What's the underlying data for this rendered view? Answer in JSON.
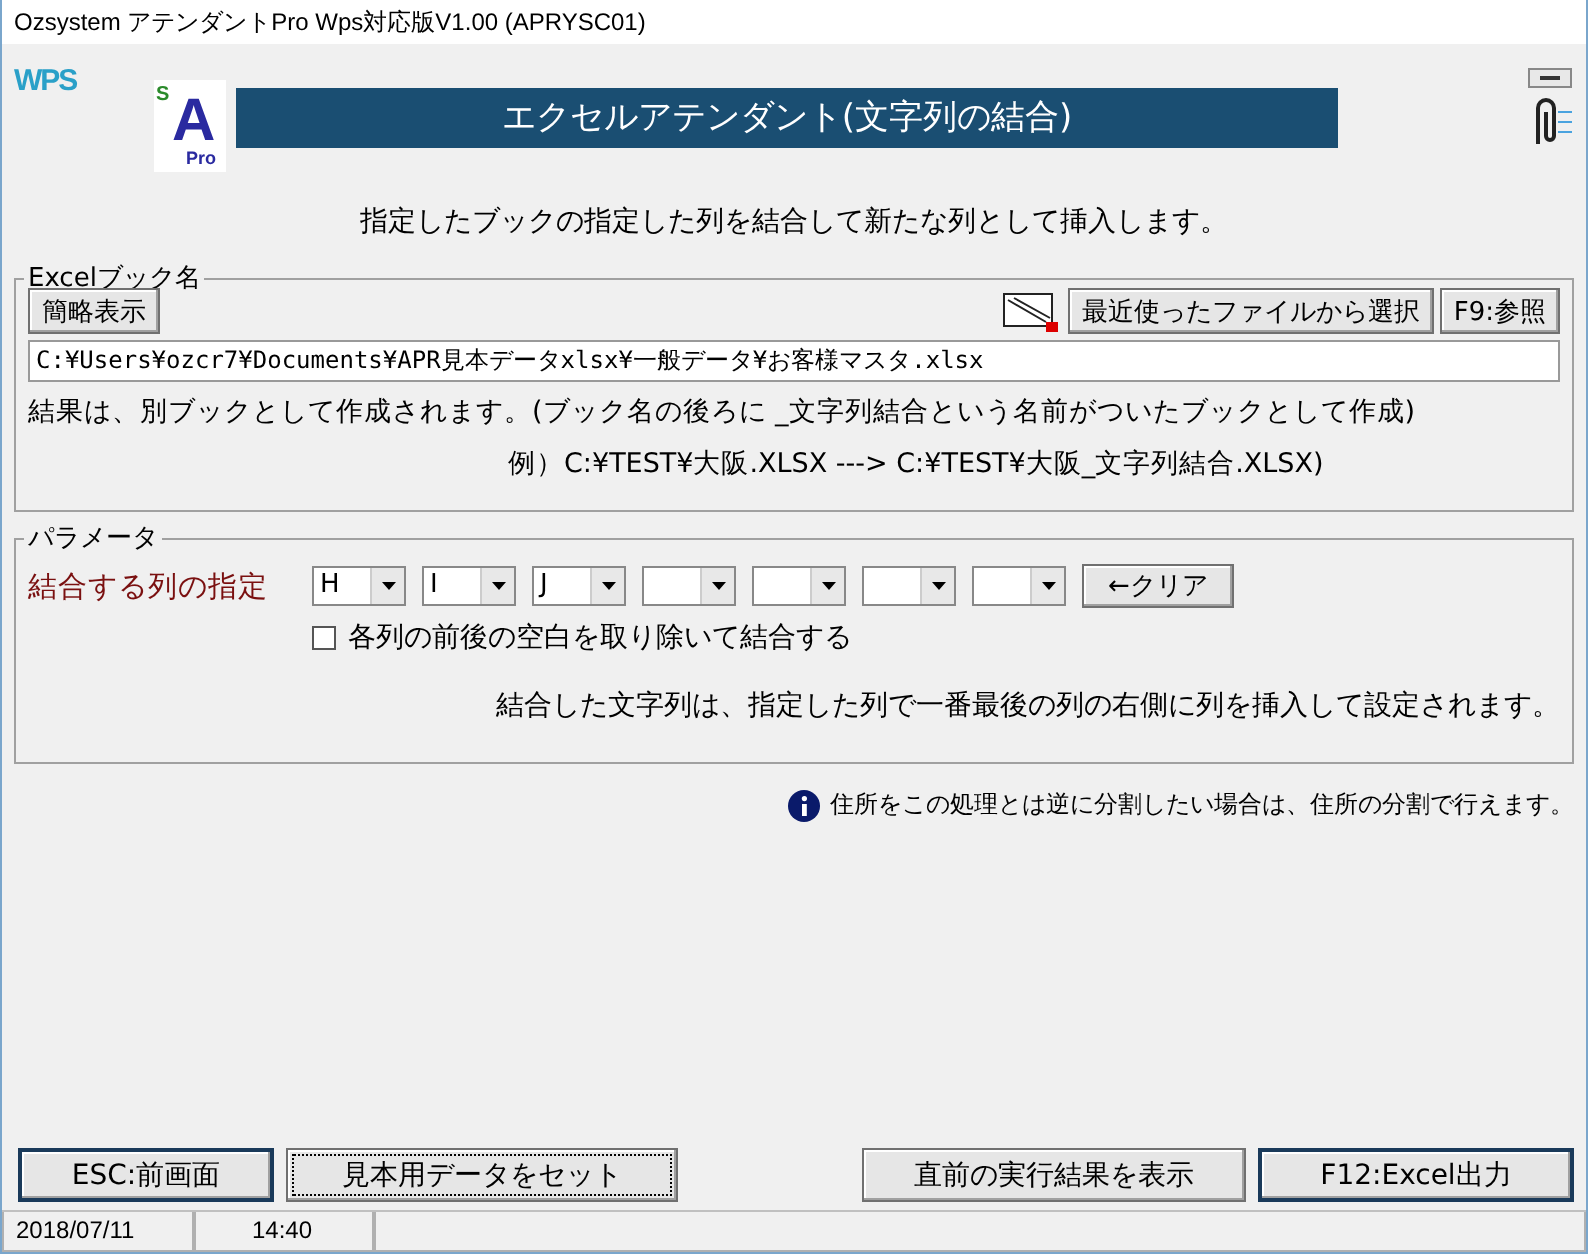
{
  "window": {
    "title": "Ozsystem アテンダントPro Wps対応版V1.00 (APRYSC01)"
  },
  "header": {
    "wps_logo": "WPS",
    "app_logo": {
      "small": "S",
      "big": "A",
      "sub": "Pro"
    },
    "banner": "エクセルアテンダント(文字列の結合)"
  },
  "instruction": "指定したブックの指定した列を結合して新たな列として挿入します。",
  "book_group": {
    "legend": "Excelブック名",
    "toggle_button": "簡略表示",
    "recent_button": "最近使ったファイルから選択",
    "browse_button": "F9:参照",
    "path": "C:¥Users¥ozcr7¥Documents¥APR見本データxlsx¥一般データ¥お客様マスタ.xlsx",
    "note": "結果は、別ブックとして作成されます。(ブック名の後ろに _文字列結合という名前がついたブックとして作成)",
    "example": "例）C:¥TEST¥大阪.XLSX ---> C:¥TEST¥大阪_文字列結合.XLSX)"
  },
  "param_group": {
    "legend": "パラメータ",
    "label": "結合する列の指定",
    "columns": [
      {
        "value": "H"
      },
      {
        "value": "I"
      },
      {
        "value": "J"
      },
      {},
      {},
      {},
      {}
    ],
    "clear_button": "←クリア",
    "trim_option": {
      "label": "各列の前後の空白を取り除いて結合する",
      "checked": false
    },
    "note": "結合した文字列は、指定した列で一番最後の列の右側に列を挿入して設定されます。"
  },
  "info": "住所をこの処理とは逆に分割したい場合は、住所の分割で行えます。",
  "buttons": [
    {
      "label": "ESC:前画面",
      "default": true,
      "focused": false
    },
    {
      "label": "見本用データをセット",
      "default": false,
      "focused": true
    },
    {
      "label": "直前の実行結果を表示",
      "default": false,
      "focused": false
    },
    {
      "label": "F12:Excel出力",
      "default": true,
      "focused": false
    }
  ],
  "status_bar": {
    "date": "2018/07/11",
    "time": "14:40"
  }
}
